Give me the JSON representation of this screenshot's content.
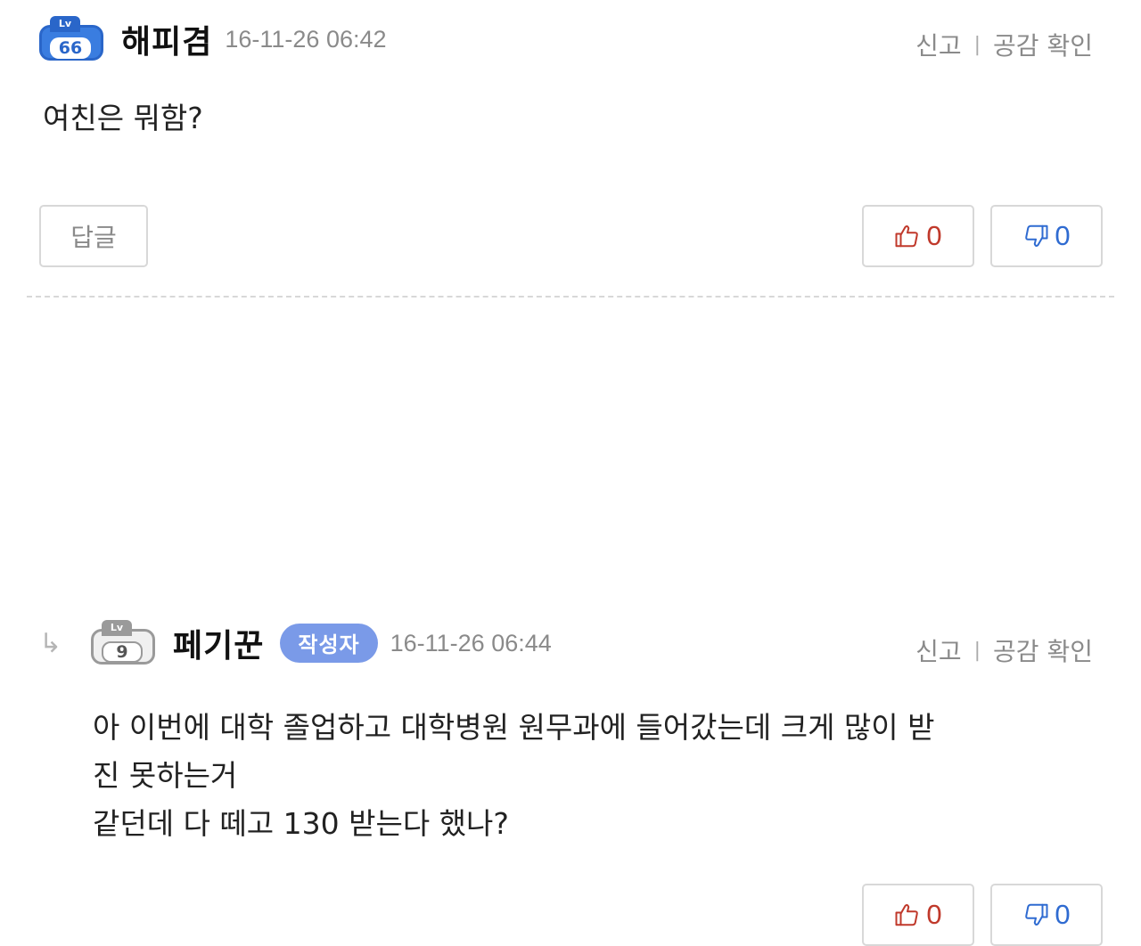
{
  "comments": [
    {
      "level_tab": "Lv",
      "level": "66",
      "nickname": "해피겸",
      "time": "16-11-26 06:42",
      "report": "신고",
      "separator": "|",
      "check_likes": "공감 확인",
      "text": "여친은 뭐함?",
      "reply_label": "답글",
      "upvotes": "0",
      "downvotes": "0"
    },
    {
      "level_tab": "Lv",
      "level": "9",
      "reply_arrow": "↳",
      "nickname": "페기꾼",
      "author_badge": "작성자",
      "time": "16-11-26 06:44",
      "report": "신고",
      "separator": "|",
      "check_likes": "공감 확인",
      "text_lines": [
        "아 이번에 대학 졸업하고 대학병원 원무과에 들어갔는데 크게 많이 받",
        "진 못하는거",
        "같던데 다 떼고 130 받는다 했나?"
      ],
      "upvotes": "0",
      "downvotes": "0"
    }
  ],
  "colors": {
    "upvote": "#c0392b",
    "downvote": "#2f6bd1",
    "badge": "#7a9ae8",
    "level_blue": "#3a7de0"
  },
  "icons": {
    "upvote": "thumbs-up-icon",
    "downvote": "thumbs-down-icon",
    "reply": "reply-arrow-icon"
  }
}
